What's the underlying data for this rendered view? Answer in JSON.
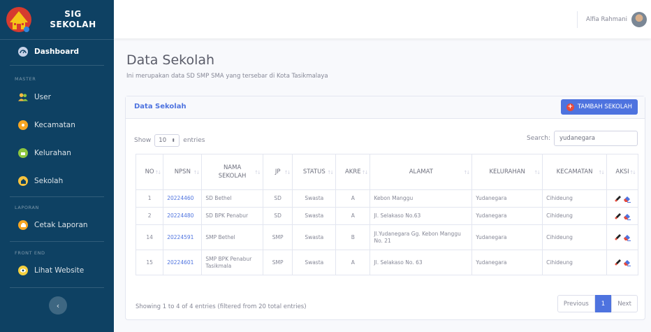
{
  "sidebar": {
    "brand_line1": "SIG",
    "brand_line2": "SEKOLAH",
    "items": [
      {
        "label": "Dashboard",
        "icon": "dashboard-icon",
        "color": "#c7d2e8"
      },
      {
        "label": "User",
        "icon": "users-icon",
        "color": "#f4b942"
      },
      {
        "label": "Kecamatan",
        "icon": "kecamatan-icon",
        "color": "#f6a623"
      },
      {
        "label": "Kelurahan",
        "icon": "kelurahan-icon",
        "color": "#8dc63f"
      },
      {
        "label": "Sekolah",
        "icon": "school-icon",
        "color": "#f6c23e"
      },
      {
        "label": "Cetak Laporan",
        "icon": "print-icon",
        "color": "#f6a623"
      },
      {
        "label": "Lihat Website",
        "icon": "eye-icon",
        "color": "#f4d03f"
      }
    ],
    "headings": [
      "MASTER",
      "LAPORAN",
      "FRONT END"
    ],
    "toggle": "‹"
  },
  "topbar": {
    "user_name": "Alfia Rahmani"
  },
  "page": {
    "title": "Data Sekolah",
    "subtitle": "Ini merupakan data SD SMP SMA yang tersebar di Kota Tasikmalaya"
  },
  "card": {
    "title": "Data Sekolah",
    "add_button": "TAMBAH SEKOLAH",
    "show_label": "Show",
    "entries_value": "10",
    "entries_label": "entries",
    "search_label": "Search:",
    "search_value": "yudanegara",
    "columns": [
      "NO",
      "NPSN",
      "NAMA SEKOLAH",
      "JP",
      "STATUS",
      "AKRE",
      "ALAMAT",
      "KELURAHAN",
      "KECAMATAN",
      "AKSI"
    ],
    "rows": [
      {
        "no": "1",
        "npsn": "20224460",
        "nama": "SD Bethel",
        "jp": "SD",
        "status": "Swasta",
        "akre": "A",
        "alamat": "Kebon Manggu",
        "kelurahan": "Yudanegara",
        "kecamatan": "Cihideung"
      },
      {
        "no": "2",
        "npsn": "20224480",
        "nama": "SD BPK Penabur",
        "jp": "SD",
        "status": "Swasta",
        "akre": "A",
        "alamat": "Jl. Selakaso No.63",
        "kelurahan": "Yudanegara",
        "kecamatan": "Cihideung"
      },
      {
        "no": "14",
        "npsn": "20224591",
        "nama": "SMP Bethel",
        "jp": "SMP",
        "status": "Swasta",
        "akre": "B",
        "alamat": "Jl.Yudanegara Gg. Kebon Manggu No. 21",
        "kelurahan": "Yudanegara",
        "kecamatan": "Cihideung"
      },
      {
        "no": "15",
        "npsn": "20224601",
        "nama": "SMP BPK Penabur Tasikmala",
        "jp": "SMP",
        "status": "Swasta",
        "akre": "A",
        "alamat": "Jl. Selakaso No. 63",
        "kelurahan": "Yudanegara",
        "kecamatan": "Cihideung"
      }
    ],
    "info": "Showing 1 to 4 of 4 entries (filtered from 20 total entries)",
    "pagination": {
      "previous": "Previous",
      "current": "1",
      "next": "Next"
    }
  }
}
